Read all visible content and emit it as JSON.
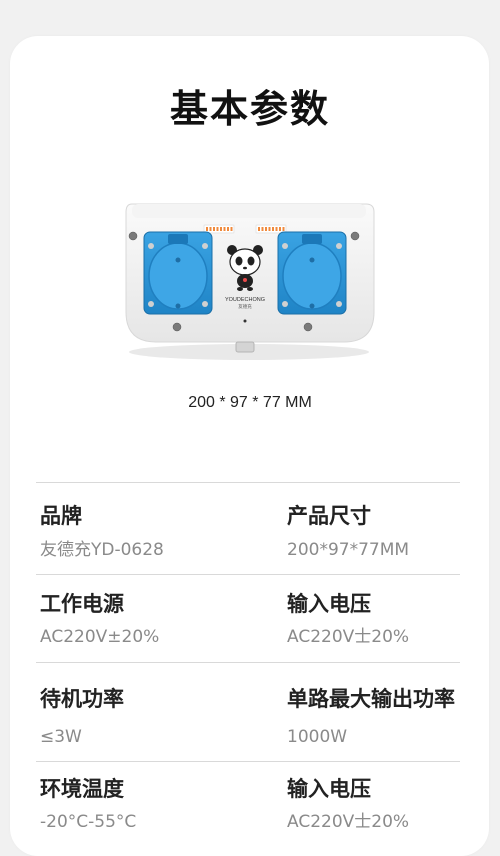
{
  "title": "基本参数",
  "product": {
    "brand_mark": "YOUDECHONG",
    "brand_mark_cn": "友德充"
  },
  "dimensions_caption": "200 * 97 * 77 MM",
  "specs": [
    {
      "label": "品牌",
      "value": "友德充YD-0628"
    },
    {
      "label": "产品尺寸",
      "value": "200*97*77MM"
    },
    {
      "label": "工作电源",
      "value": "AC220V±20%"
    },
    {
      "label": "输入电压",
      "value": "AC220V士20%"
    },
    {
      "label": "待机功率",
      "value": "≤3W"
    },
    {
      "label": "单路最大输出功率",
      "value": "1000W"
    },
    {
      "label": "环境温度",
      "value": "-20°C-55°C"
    },
    {
      "label": "输入电压",
      "value": "AC220V士20%"
    }
  ],
  "colors": {
    "background": "#f1f1f1",
    "card": "#ffffff",
    "socket_blue": "#2a95d6",
    "divider": "#d9d9d9",
    "value_text": "#8a8a8a"
  }
}
